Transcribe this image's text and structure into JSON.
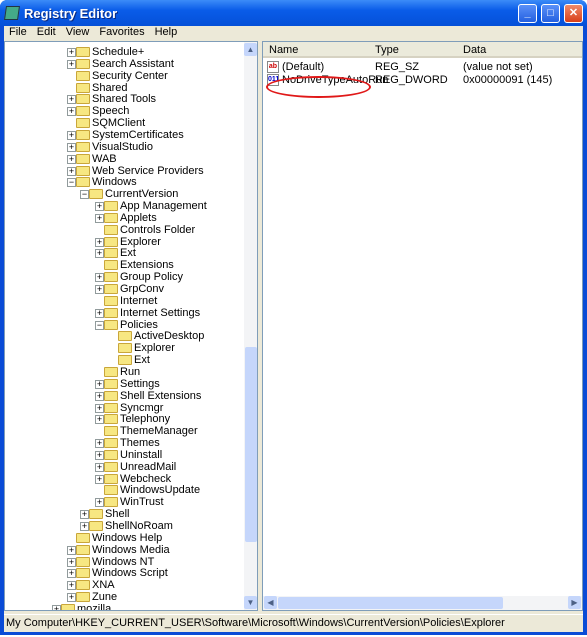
{
  "window": {
    "title": "Registry Editor",
    "buttons": {
      "minimize": "_",
      "maximize": "□",
      "close": "✕"
    }
  },
  "menu": [
    "File",
    "Edit",
    "View",
    "Favorites",
    "Help"
  ],
  "tree": [
    {
      "name": "Schedule+",
      "level": 1,
      "exp": "+"
    },
    {
      "name": "Search Assistant",
      "level": 1,
      "exp": "+"
    },
    {
      "name": "Security Center",
      "level": 1,
      "exp": ""
    },
    {
      "name": "Shared",
      "level": 1,
      "exp": ""
    },
    {
      "name": "Shared Tools",
      "level": 1,
      "exp": "+"
    },
    {
      "name": "Speech",
      "level": 1,
      "exp": "+"
    },
    {
      "name": "SQMClient",
      "level": 1,
      "exp": ""
    },
    {
      "name": "SystemCertificates",
      "level": 1,
      "exp": "+"
    },
    {
      "name": "VisualStudio",
      "level": 1,
      "exp": "+"
    },
    {
      "name": "WAB",
      "level": 1,
      "exp": "+"
    },
    {
      "name": "Web Service Providers",
      "level": 1,
      "exp": "+"
    },
    {
      "name": "Windows",
      "level": 1,
      "exp": "-"
    },
    {
      "name": "CurrentVersion",
      "level": 2,
      "exp": "-"
    },
    {
      "name": "App Management",
      "level": 3,
      "exp": "+"
    },
    {
      "name": "Applets",
      "level": 3,
      "exp": "+"
    },
    {
      "name": "Controls Folder",
      "level": 3,
      "exp": ""
    },
    {
      "name": "Explorer",
      "level": 3,
      "exp": "+"
    },
    {
      "name": "Ext",
      "level": 3,
      "exp": "+"
    },
    {
      "name": "Extensions",
      "level": 3,
      "exp": ""
    },
    {
      "name": "Group Policy",
      "level": 3,
      "exp": "+"
    },
    {
      "name": "GrpConv",
      "level": 3,
      "exp": "+"
    },
    {
      "name": "Internet",
      "level": 3,
      "exp": ""
    },
    {
      "name": "Internet Settings",
      "level": 3,
      "exp": "+"
    },
    {
      "name": "Policies",
      "level": 3,
      "exp": "-"
    },
    {
      "name": "ActiveDesktop",
      "level": 4,
      "exp": ""
    },
    {
      "name": "Explorer",
      "level": 4,
      "exp": "",
      "selected": true
    },
    {
      "name": "Ext",
      "level": 4,
      "exp": ""
    },
    {
      "name": "Run",
      "level": 3,
      "exp": ""
    },
    {
      "name": "Settings",
      "level": 3,
      "exp": "+"
    },
    {
      "name": "Shell Extensions",
      "level": 3,
      "exp": "+"
    },
    {
      "name": "Syncmgr",
      "level": 3,
      "exp": "+"
    },
    {
      "name": "Telephony",
      "level": 3,
      "exp": "+"
    },
    {
      "name": "ThemeManager",
      "level": 3,
      "exp": ""
    },
    {
      "name": "Themes",
      "level": 3,
      "exp": "+"
    },
    {
      "name": "Uninstall",
      "level": 3,
      "exp": "+"
    },
    {
      "name": "UnreadMail",
      "level": 3,
      "exp": "+"
    },
    {
      "name": "Webcheck",
      "level": 3,
      "exp": "+"
    },
    {
      "name": "WindowsUpdate",
      "level": 3,
      "exp": ""
    },
    {
      "name": "WinTrust",
      "level": 3,
      "exp": "+"
    },
    {
      "name": "Shell",
      "level": 2,
      "exp": "+"
    },
    {
      "name": "ShellNoRoam",
      "level": 2,
      "exp": "+"
    },
    {
      "name": "Windows Help",
      "level": 1,
      "exp": ""
    },
    {
      "name": "Windows Media",
      "level": 1,
      "exp": "+"
    },
    {
      "name": "Windows NT",
      "level": 1,
      "exp": "+"
    },
    {
      "name": "Windows Script",
      "level": 1,
      "exp": "+"
    },
    {
      "name": "XNA",
      "level": 1,
      "exp": "+"
    },
    {
      "name": "Zune",
      "level": 1,
      "exp": "+"
    },
    {
      "name": "mozilla",
      "level": 0,
      "exp": "+"
    }
  ],
  "list": {
    "headers": {
      "name": "Name",
      "type": "Type",
      "data": "Data"
    },
    "rows": [
      {
        "icon": "ab",
        "name": "(Default)",
        "type": "REG_SZ",
        "data": "(value not set)"
      },
      {
        "icon": "011",
        "name": "NoDriveTypeAutoRun",
        "type": "REG_DWORD",
        "data": "0x00000091 (145)",
        "highlighted": true
      }
    ]
  },
  "status": "My Computer\\HKEY_CURRENT_USER\\Software\\Microsoft\\Windows\\CurrentVersion\\Policies\\Explorer",
  "colors": {
    "annotation": "#e01818",
    "titlebar": "#0a5ce8"
  }
}
